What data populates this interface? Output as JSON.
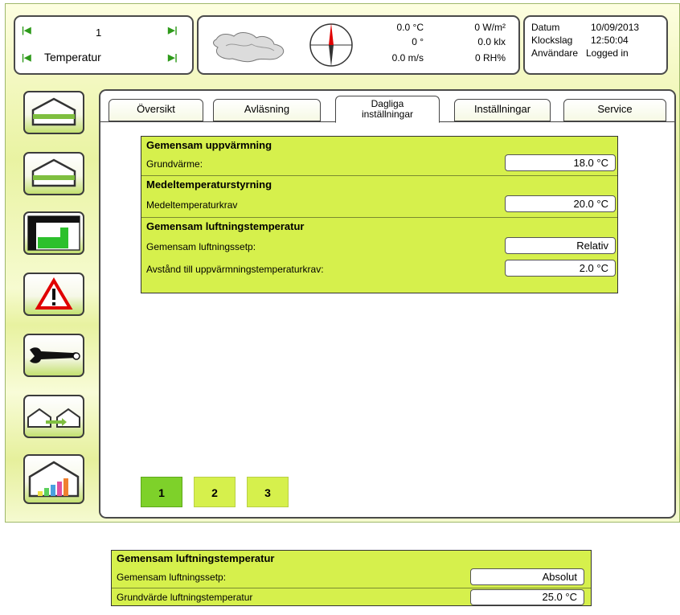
{
  "nav": {
    "number": "1",
    "title": "Temperatur"
  },
  "weather": {
    "temperature": "0.0 °C",
    "direction": "0 °",
    "wind_speed": "0.0 m/s",
    "radiation": "0 W/m²",
    "light": "0.0 klx",
    "humidity": "0 RH%"
  },
  "info": {
    "date_label": "Datum",
    "date_value": "10/09/2013",
    "time_label": "Klockslag",
    "time_value": "12:50:04",
    "user_label": "Användare",
    "user_value": "Logged in"
  },
  "side_buttons": [
    {
      "icon": "greenhouse-icon"
    },
    {
      "icon": "greenhouse-icon"
    },
    {
      "icon": "table-graph-icon"
    },
    {
      "icon": "warning-icon"
    },
    {
      "icon": "wrench-icon"
    },
    {
      "icon": "greenhouse-transfer-icon"
    },
    {
      "icon": "greenhouse-chart-icon"
    }
  ],
  "tabs": [
    {
      "label": "Översikt"
    },
    {
      "label": "Avläsning"
    },
    {
      "label": "Dagliga inställningar",
      "line1": "Dagliga",
      "line2": "inställningar",
      "active": true
    },
    {
      "label": "Inställningar"
    },
    {
      "label": "Service"
    }
  ],
  "main_settings": {
    "sections": [
      {
        "title": "Gemensam uppvärmning",
        "rows": [
          {
            "label": "Grundvärme:",
            "value": "18.0 °C"
          }
        ]
      },
      {
        "title": "Medeltemperaturstyrning",
        "rows": [
          {
            "label": "Medeltemperaturkrav",
            "value": "20.0 °C"
          }
        ]
      },
      {
        "title": "Gemensam luftningstemperatur",
        "rows": [
          {
            "label": "Gemensam luftningssetp:",
            "value": "Relativ"
          },
          {
            "label": "Avstånd till uppvärmningstemperaturkrav:",
            "value": "2.0 °C"
          }
        ]
      }
    ]
  },
  "pages": [
    {
      "label": "1",
      "active": true
    },
    {
      "label": "2",
      "active": false
    },
    {
      "label": "3",
      "active": false
    }
  ],
  "extra_settings": {
    "title": "Gemensam luftningstemperatur",
    "rows": [
      {
        "label": "Gemensam luftningssetp:",
        "value": "Absolut"
      },
      {
        "label": "Grundvärde luftningstemperatur",
        "value": "25.0 °C"
      }
    ]
  },
  "colors": {
    "accent_green": "#d6f04c",
    "active_green": "#7ed12a",
    "compass_red": "#e00000"
  }
}
